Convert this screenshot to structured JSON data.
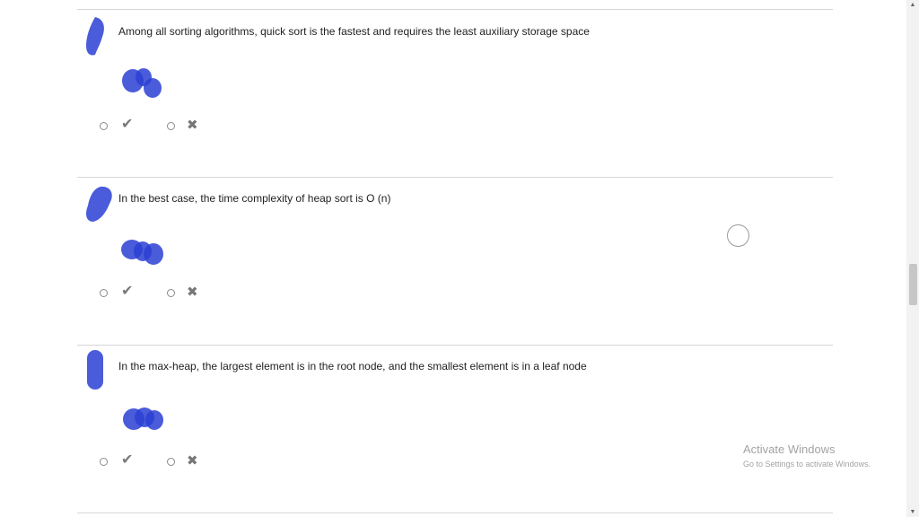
{
  "questions": [
    {
      "text": "Among all sorting algorithms, quick sort is the fastest and requires the least auxiliary storage space",
      "true_icon": "check-icon",
      "false_icon": "cross-icon"
    },
    {
      "text": "In the best case, the time complexity of heap sort is O (n)",
      "true_icon": "check-icon",
      "false_icon": "cross-icon"
    },
    {
      "text": "In the max-heap, the largest element is in the root node, and the smallest element is in a leaf node",
      "true_icon": "check-icon",
      "false_icon": "cross-icon"
    }
  ],
  "watermark": {
    "title": "Activate Windows",
    "subtitle": "Go to Settings to activate Windows."
  },
  "colors": {
    "scribble_blue": "#2a3fd4",
    "divider": "#d6d6d6"
  },
  "icons": {
    "check": "✔",
    "cross": "✖"
  }
}
